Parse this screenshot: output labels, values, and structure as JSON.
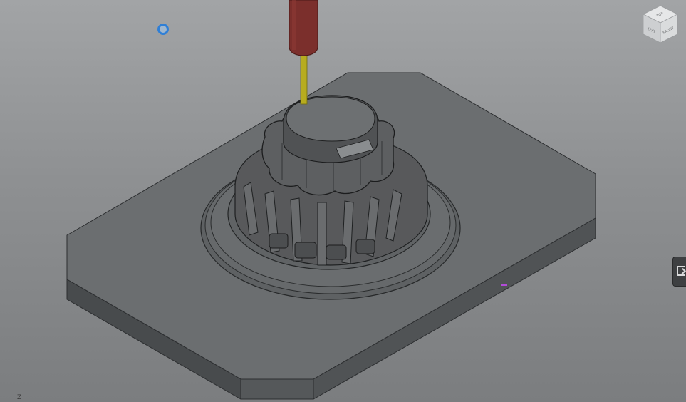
{
  "viewport": {
    "viewcube": {
      "top": "TOP",
      "left": "LEFT",
      "front": "FRONT"
    },
    "axis_label": "Z",
    "icons": {
      "pivot": "orbit-pivot-icon",
      "side_panel_toggle": "panel-collapse-icon"
    },
    "colors": {
      "tool_holder": "#7b2f2c",
      "tool_shank": "#b7ac1f",
      "pivot": "#2f7fd6",
      "marker": "#b24bd8",
      "stock_top": "#6c6f71",
      "stock_side": "#4a4d4f"
    }
  }
}
